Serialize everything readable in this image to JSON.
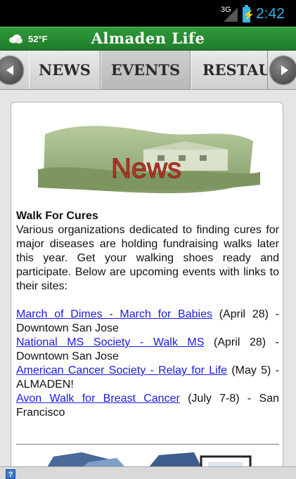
{
  "status_bar": {
    "network": "3G",
    "time": "2:42",
    "battery_glyph": "⚡",
    "accent_color": "#33b5e5"
  },
  "title_bar": {
    "temperature": "52°F",
    "weather_icon": "cloud-icon",
    "title": "Almaden Life",
    "color": "#2f9a3b"
  },
  "tabs": [
    {
      "label": "NEWS"
    },
    {
      "label": "EVENTS"
    },
    {
      "label": "RESTAU"
    }
  ],
  "nav": {
    "left_icon": "chevron-left-icon",
    "right_icon": "chevron-right-icon"
  },
  "article": {
    "banner_text": "News",
    "headline": "Walk For Cures",
    "body": "Various organizations dedicated to finding cures for major diseases are holding fundraising walks later this year.  Get your walking shoes ready and participate.  Below are upcoming events with links to their sites:",
    "events": [
      {
        "link": "March of Dimes - March for Babies",
        "detail": " (April 28) - Downtown San Jose"
      },
      {
        "link": "National MS Society - Walk MS",
        "detail": " (April 28) - Downtown San Jose"
      },
      {
        "link": "American Cancer Society - Relay for Life",
        "detail": " (May 5) - ALMADEN!"
      },
      {
        "link": "Avon Walk for Breast Cancer",
        "detail": " (July 7-8) - San Francisco"
      }
    ],
    "link_color": "#1a1ae6"
  },
  "bottom_bar": {
    "help_label": "?"
  }
}
